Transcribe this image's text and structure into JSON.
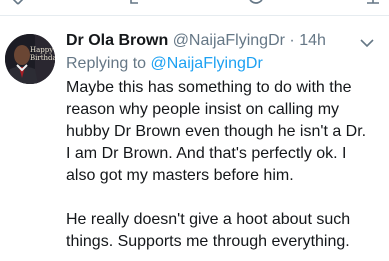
{
  "prev_tweet_actions": [
    {
      "name": "reply-icon"
    },
    {
      "name": "retweet-icon"
    },
    {
      "name": "like-icon"
    },
    {
      "name": "share-icon"
    }
  ],
  "tweet": {
    "avatar": {
      "caption": "Happy 64\nBirthday",
      "icon": "profile-photo"
    },
    "display_name": "Dr Ola Brown",
    "handle": "@NaijaFlyingDr",
    "separator": "·",
    "time": "14h",
    "replying_prefix": "Replying to",
    "replying_to": "@NaijaFlyingDr",
    "body_lines": [
      "Maybe this has something to do with the",
      "reason why people insist on calling my",
      "hubby Dr Brown even though he isn't a Dr.",
      "I am Dr Brown. And that's perfectly ok. I",
      "also got my masters before him."
    ],
    "body_lines_2": [
      "He really doesn't give a hoot about such",
      "things. Supports me through everything."
    ]
  },
  "colors": {
    "text": "#14171a",
    "muted": "#657786",
    "link": "#1da1f2",
    "divider": "#e6ecf0"
  }
}
